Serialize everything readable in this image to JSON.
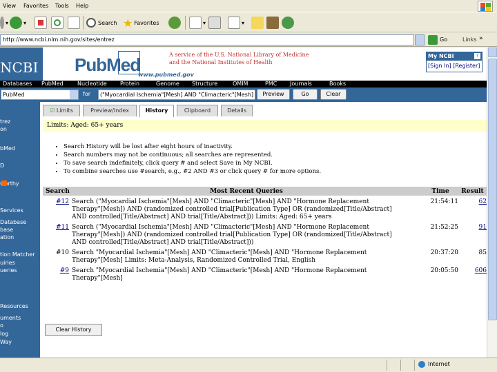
{
  "menubar": {
    "items": [
      "View",
      "Favorites",
      "Tools",
      "Help"
    ]
  },
  "toolbar": {
    "search_label": "Search",
    "favorites_label": "Favorites"
  },
  "address": {
    "url": "http://www.ncbi.nlm.nih.gov/sites/entrez",
    "go_label": "Go",
    "links_label": "Links",
    "chevron": "»"
  },
  "header": {
    "ncbi": "NCBI",
    "pubmed": "PubMed",
    "pubmed_url": "www.pubmed.gov",
    "service_line1": "A service of the U.S. National Library of Medicine",
    "service_line2": "and the National Institutes of Health",
    "myncbi_title": "My NCBI",
    "myncbi_help": "?",
    "myncbi_link": "[Sign In] [Register]"
  },
  "navbar": {
    "items": [
      "Databases",
      "PubMed",
      "Nucleotide",
      "Protein",
      "Genome",
      "Structure",
      "OMIM",
      "PMC",
      "Journals",
      "Books"
    ]
  },
  "search": {
    "database": "PubMed",
    "for_label": "for",
    "term": "(\"Myocardial Ischemia\"[Mesh] AND \"Climacteric\"[Mesh] AND",
    "preview_label": "Preview",
    "go_label": "Go",
    "clear_label": "Clear"
  },
  "sidebar": {
    "items": [
      "trez",
      "on",
      "bMed",
      "D",
      "worthy",
      "Services",
      "Database",
      "base",
      "ation",
      "tion Matcher",
      "uiries",
      "ueries",
      "Resources",
      "uments",
      "o",
      "log",
      "Way"
    ]
  },
  "tabs": [
    "Limits",
    "Preview/Index",
    "History",
    "Clipboard",
    "Details"
  ],
  "limits_text": "Limits: Aged: 65+ years",
  "bullets": [
    "Search History will be lost after eight hours of inactivity.",
    "Search numbers may not be continuous; all searches are represented.",
    "To save search indefinitely, click query # and select Save in My NCBI.",
    "To combine searches use #search, e.g., #2 AND #3 or click query # for more options."
  ],
  "history": {
    "headers": {
      "search": "Search",
      "queries": "Most Recent Queries",
      "time": "Time",
      "result": "Result"
    },
    "rows": [
      {
        "num": "#12",
        "query_lines": [
          "Search (\"Myocardial Ischemia\"[Mesh] AND \"Climacteric\"[Mesh] AND \"Hormone Replacement",
          "Therapy\"[Mesh]) AND (randomized controlled trial[Publication Type] OR (randomized[Title/Abstract]",
          "AND controlled[Title/Abstract] AND trial[Title/Abstract])) Limits: Aged: 65+ years"
        ],
        "time": "21:54:11",
        "result": "62",
        "result_link": true
      },
      {
        "num": "#11",
        "query_lines": [
          "Search (\"Myocardial Ischemia\"[Mesh] AND \"Climacteric\"[Mesh] AND \"Hormone Replacement",
          "Therapy\"[Mesh]) AND (randomized controlled trial[Publication Type] OR (randomized[Title/Abstract]",
          "AND controlled[Title/Abstract] AND trial[Title/Abstract]))"
        ],
        "time": "21:52:25",
        "result": "91",
        "result_link": true
      },
      {
        "num": "#10",
        "query_lines": [
          "Search \"Myocardial Ischemia\"[Mesh] AND \"Climacteric\"[Mesh] AND \"Hormone Replacement",
          "Therapy\"[Mesh] Limits: Meta-Analysis, Randomized Controlled Trial, English"
        ],
        "time": "20:37:20",
        "result": "85",
        "result_link": false
      },
      {
        "num": "#9",
        "query_lines": [
          "Search \"Myocardial Ischemia\"[Mesh] AND \"Climacteric\"[Mesh] AND \"Hormone Replacement",
          "Therapy\"[Mesh]"
        ],
        "time": "20:05:50",
        "result": "606",
        "result_link": true
      }
    ]
  },
  "clear_history_label": "Clear History",
  "status": {
    "zone": "Internet"
  }
}
